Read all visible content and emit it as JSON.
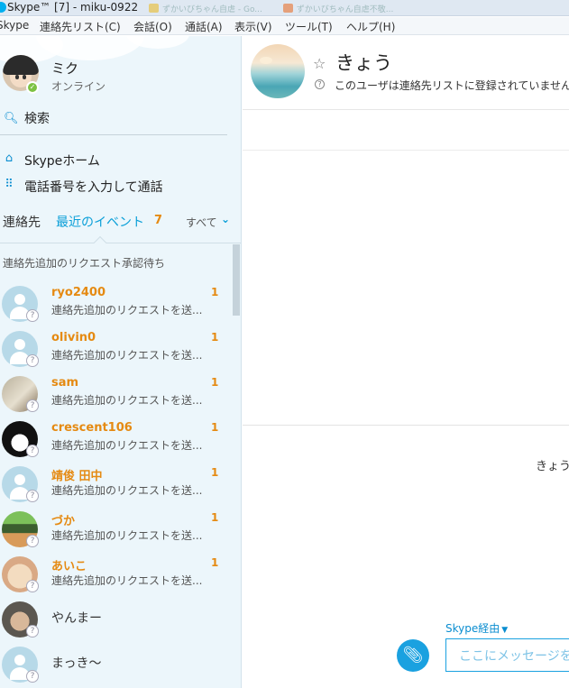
{
  "window": {
    "title": "Skype™ [7] - miku-0922",
    "background_tabs": [
      "ずかいびちゃん自虐 - Go...",
      "ずかいびちゃん自虐不敬..."
    ]
  },
  "menu": {
    "items": [
      "Skype",
      "連絡先リスト(C)",
      "会話(O)",
      "通話(A)",
      "表示(V)",
      "ツール(T)",
      "ヘルプ(H)"
    ]
  },
  "profile": {
    "name": "ミク",
    "status": "オンライン"
  },
  "search": {
    "label": "検索"
  },
  "nav": {
    "home": "Skypeホーム",
    "dial": "電話番号を入力して通話"
  },
  "tabs": {
    "contacts": "連絡先",
    "recent": "最近のイベント",
    "recent_count": "7",
    "filter": "すべて"
  },
  "section": {
    "pending_header": "連絡先追加のリクエスト承認待ち"
  },
  "contacts": [
    {
      "name": "ryo2400",
      "subtitle": "連絡先追加のリクエストを送...",
      "badge": "1"
    },
    {
      "name": "olivin0",
      "subtitle": "連絡先追加のリクエストを送...",
      "badge": "1"
    },
    {
      "name": "sam",
      "subtitle": "連絡先追加のリクエストを送...",
      "badge": "1"
    },
    {
      "name": "crescent106",
      "subtitle": "連絡先追加のリクエストを送...",
      "badge": "1"
    },
    {
      "name": "靖俊 田中",
      "subtitle": "連絡先追加のリクエストを送...",
      "badge": "1"
    },
    {
      "name": "づか",
      "subtitle": "連絡先追加のリクエストを送...",
      "badge": "1"
    },
    {
      "name": "あいこ",
      "subtitle": "連絡先追加のリクエストを送...",
      "badge": "1"
    },
    {
      "name": "やんまー"
    },
    {
      "name": "まっき～"
    }
  ],
  "chat": {
    "name": "きょう",
    "subtitle": "このユーザは連絡先リストに登録されていません",
    "message_sender": "きょう",
    "via": "Skype経由",
    "input_placeholder": "ここにメッセージを入力"
  },
  "colors": {
    "accent": "#0a9fd8",
    "badge": "#e58a12",
    "sidebar_bg": "#ecf6fb",
    "online": "#7dc242"
  }
}
